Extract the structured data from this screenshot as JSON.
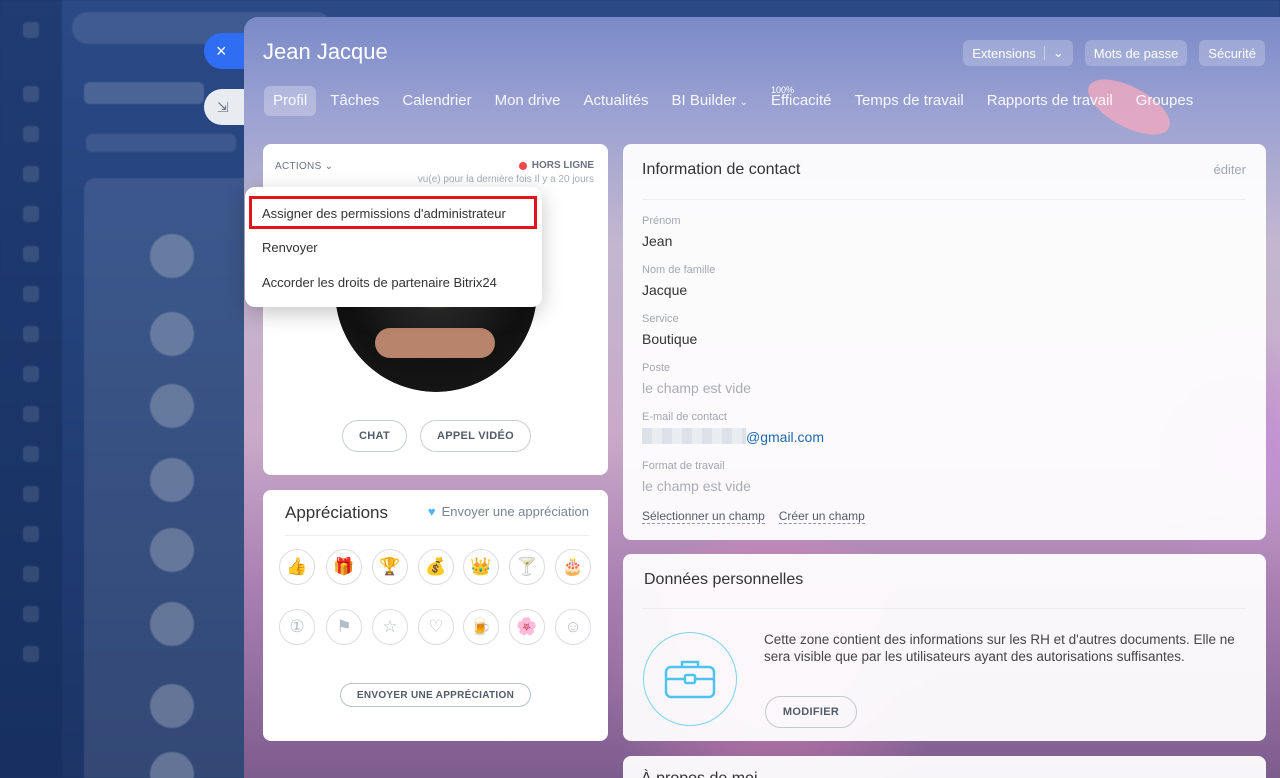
{
  "background": {
    "sidebar_icons": 16,
    "list_rows": 8
  },
  "slider": {
    "close_icon": "×",
    "collapse_icon": "⇲",
    "user_name": "Jean Jacque",
    "header_buttons": {
      "extensions": "Extensions",
      "passwords": "Mots de passe",
      "security": "Sécurité"
    },
    "tabs": [
      {
        "label": "Profil"
      },
      {
        "label": "Tâches"
      },
      {
        "label": "Calendrier"
      },
      {
        "label": "Mon drive"
      },
      {
        "label": "Actualités"
      },
      {
        "label": "BI Builder"
      },
      {
        "label": "Efficacité",
        "sup": "100%"
      },
      {
        "label": "Temps de travail"
      },
      {
        "label": "Rapports de travail"
      },
      {
        "label": "Groupes"
      }
    ]
  },
  "profile": {
    "actions_label": "ACTIONS",
    "status": "HORS LIGNE",
    "last_seen": "vu(e) pour la dernière fois Il y a 20 jours",
    "chat_button": "CHAT",
    "video_button": "APPEL VIDÉO"
  },
  "menu": {
    "items": [
      "Assigner des permissions d'administrateur",
      "Renvoyer",
      "Accorder les droits de partenaire Bitrix24"
    ]
  },
  "appreciations": {
    "title": "Appréciations",
    "send_link": "Envoyer une appréciation",
    "badges": [
      "👍",
      "🎁",
      "🏆",
      "💰",
      "👑",
      "🍸",
      "🎂",
      "①",
      "⚑",
      "☆",
      "♡",
      "🍺",
      "🌸",
      "☺"
    ],
    "send_button": "ENVOYER UNE APPRÉCIATION"
  },
  "contact": {
    "title": "Information de contact",
    "edit": "éditer",
    "fields": [
      {
        "label": "Prénom",
        "value": "Jean"
      },
      {
        "label": "Nom de famille",
        "value": "Jacque"
      },
      {
        "label": "Service",
        "value": "Boutique"
      },
      {
        "label": "Poste",
        "value": "le champ est vide"
      },
      {
        "label": "E-mail de contact",
        "value": "@gmail.com"
      },
      {
        "label": "Format de travail",
        "value": "le champ est vide"
      }
    ],
    "select_field": "Sélectionner un champ",
    "create_field": "Créer un champ"
  },
  "personal": {
    "title": "Données personnelles",
    "text": "Cette zone contient des informations sur les RH et d'autres documents. Elle ne sera visible que par les utilisateurs ayant des autorisations suffisantes.",
    "edit_button": "MODIFIER",
    "icon": "briefcase-icon"
  },
  "bottom": {
    "title": "À propos de moi"
  },
  "colors": {
    "accent": "#2f6ef2",
    "offline": "#f0494c",
    "highlight": "#e3141b",
    "link": "#2067b0"
  }
}
